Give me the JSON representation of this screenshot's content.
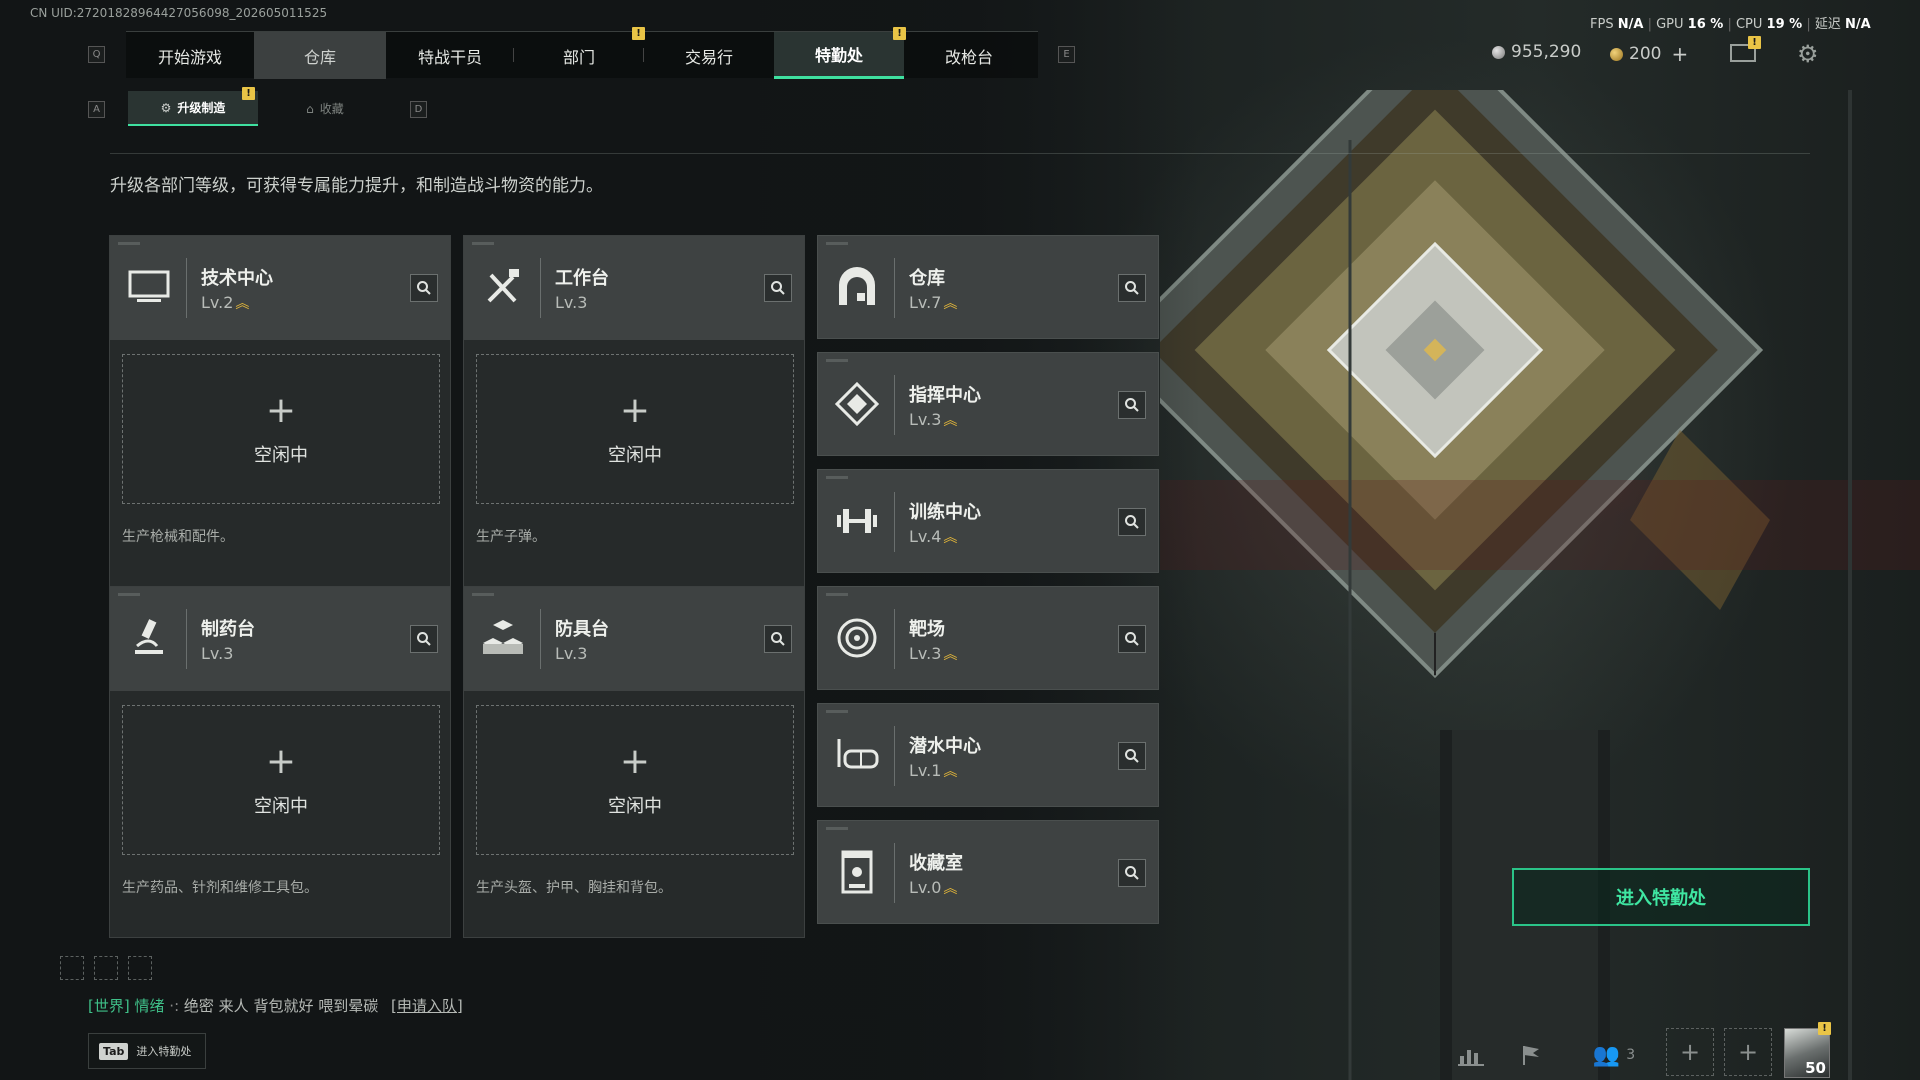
{
  "uid": "CN UID:27201828964427056098_202605011525",
  "stats": {
    "fps_label": "FPS",
    "fps": "N/A",
    "gpu_label": "GPU",
    "gpu": "16 %",
    "cpu_label": "CPU",
    "cpu": "19 %",
    "latency_label": "延迟",
    "latency": "N/A"
  },
  "nav": {
    "key_left": "Q",
    "key_right": "E",
    "tabs": [
      {
        "label": "开始游戏"
      },
      {
        "label": "仓库"
      },
      {
        "label": "特战干员"
      },
      {
        "label": "部门"
      },
      {
        "label": "交易行"
      },
      {
        "label": "特勤处"
      },
      {
        "label": "改枪台"
      }
    ]
  },
  "currency": {
    "coins": "955,290",
    "premium": "200",
    "plus": "+"
  },
  "subnav": {
    "key_left": "A",
    "key_right": "D",
    "tabs": [
      {
        "label": "升级制造"
      },
      {
        "label": "收藏"
      }
    ]
  },
  "badge_symbol": "!",
  "description": "升级各部门等级，可获得专属能力提升，和制造战斗物资的能力。",
  "production_cards": [
    {
      "name": "技术中心",
      "level": "Lv.2",
      "upgradable": true,
      "slot_plus": "+",
      "slot_status": "空闲中",
      "produces": "生产枪械和配件。",
      "icon": "monitor-icon"
    },
    {
      "name": "工作台",
      "level": "Lv.3",
      "upgradable": false,
      "slot_plus": "+",
      "slot_status": "空闲中",
      "produces": "生产子弹。",
      "icon": "tools-icon"
    },
    {
      "name": "制药台",
      "level": "Lv.3",
      "upgradable": false,
      "slot_plus": "+",
      "slot_status": "空闲中",
      "produces": "生产药品、针剂和维修工具包。",
      "icon": "microscope-icon"
    },
    {
      "name": "防具台",
      "level": "Lv.3",
      "upgradable": false,
      "slot_plus": "+",
      "slot_status": "空闲中",
      "produces": "生产头盔、护甲、胸挂和背包。",
      "icon": "armor-blocks-icon"
    }
  ],
  "facility_list": [
    {
      "name": "仓库",
      "level": "Lv.7",
      "upgradable": true,
      "icon": "vault-icon"
    },
    {
      "name": "指挥中心",
      "level": "Lv.3",
      "upgradable": true,
      "icon": "command-icon"
    },
    {
      "name": "训练中心",
      "level": "Lv.4",
      "upgradable": true,
      "icon": "dumbbell-icon"
    },
    {
      "name": "靶场",
      "level": "Lv.3",
      "upgradable": true,
      "icon": "target-icon"
    },
    {
      "name": "潜水中心",
      "level": "Lv.1",
      "upgradable": true,
      "icon": "diving-mask-icon"
    },
    {
      "name": "收藏室",
      "level": "Lv.0",
      "upgradable": true,
      "icon": "collection-icon"
    }
  ],
  "enter_button": "进入特勤处",
  "chat": {
    "channel": "[世界]",
    "user": "情绪",
    "sep": "·:",
    "message": "绝密 来人 背包就好 喂到晕碳",
    "apply": "[申请入队]"
  },
  "tab_hint": {
    "key": "Tab",
    "label": "进入特勤处"
  },
  "bottom": {
    "friends_count": "3",
    "player_level": "50"
  },
  "colors": {
    "accent": "#3fe0a0",
    "badge": "#e9c446",
    "upgrade": "#e6b93a"
  }
}
